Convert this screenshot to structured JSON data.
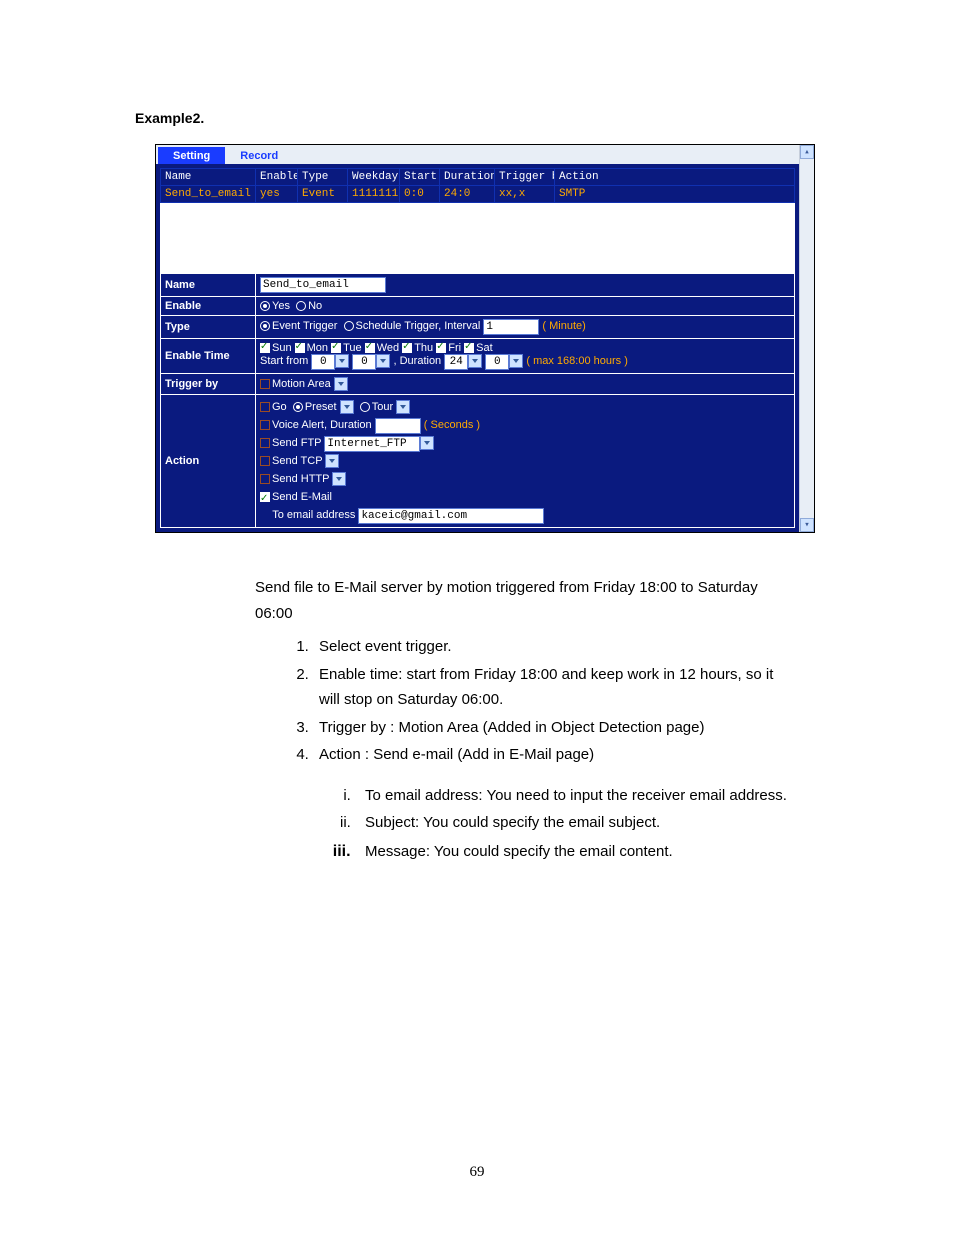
{
  "heading": "Example2.",
  "tabs": {
    "setting": "Setting",
    "record": "Record"
  },
  "table": {
    "headers": [
      "Name",
      "Enable",
      "Type",
      "Weekday",
      "Start",
      "Duration",
      "Trigger by",
      "Action"
    ],
    "row": {
      "name": "Send_to_email",
      "enable": "yes",
      "type": "Event",
      "weekday": "1111111",
      "start": "0:0",
      "duration": "24:0",
      "trigger": "xx,x",
      "action": "SMTP"
    }
  },
  "form": {
    "name_label": "Name",
    "name_value": "Send_to_email",
    "enable_label": "Enable",
    "enable_yes": "Yes",
    "enable_no": "No",
    "type_label": "Type",
    "type_event": "Event Trigger",
    "type_sched": "Schedule Trigger, Interval",
    "type_interval_value": "1",
    "type_minute": "( Minute)",
    "enable_time_label": "Enable Time",
    "days": [
      "Sun",
      "Mon",
      "Tue",
      "Wed",
      "Thu",
      "Fri",
      "Sat"
    ],
    "start_from": "Start from",
    "start_h": "0",
    "start_m": "0",
    "duration": ", Duration",
    "dur_h": "24",
    "dur_m": "0",
    "max_note": "( max 168:00 hours )",
    "trigger_label": "Trigger by",
    "trigger_motion": "Motion Area",
    "action_label": "Action",
    "go": "Go",
    "preset": "Preset",
    "tour": "Tour",
    "voice": "Voice Alert, Duration",
    "seconds": "( Seconds )",
    "send_ftp": "Send FTP",
    "ftp_value": "Internet_FTP",
    "send_tcp": "Send TCP",
    "send_http": "Send HTTP",
    "send_email": "Send E-Mail",
    "to_email": "To email address",
    "email_value": "kaceic@gmail.com"
  },
  "body": {
    "intro": "Send file to E-Mail server by motion triggered from Friday 18:00 to Saturday 06:00",
    "steps": [
      "Select event trigger.",
      "Enable time: start from Friday 18:00 and keep work in 12 hours, so it will stop on Saturday 06:00.",
      "Trigger by : Motion Area (Added in Object Detection page)",
      "Action : Send e-mail (Add in E-Mail page)"
    ],
    "substeps": [
      "To email address: You need to input the receiver email address.",
      "Subject: You could specify the email subject.",
      "Message: You could specify the email content."
    ]
  },
  "page_number": "69"
}
